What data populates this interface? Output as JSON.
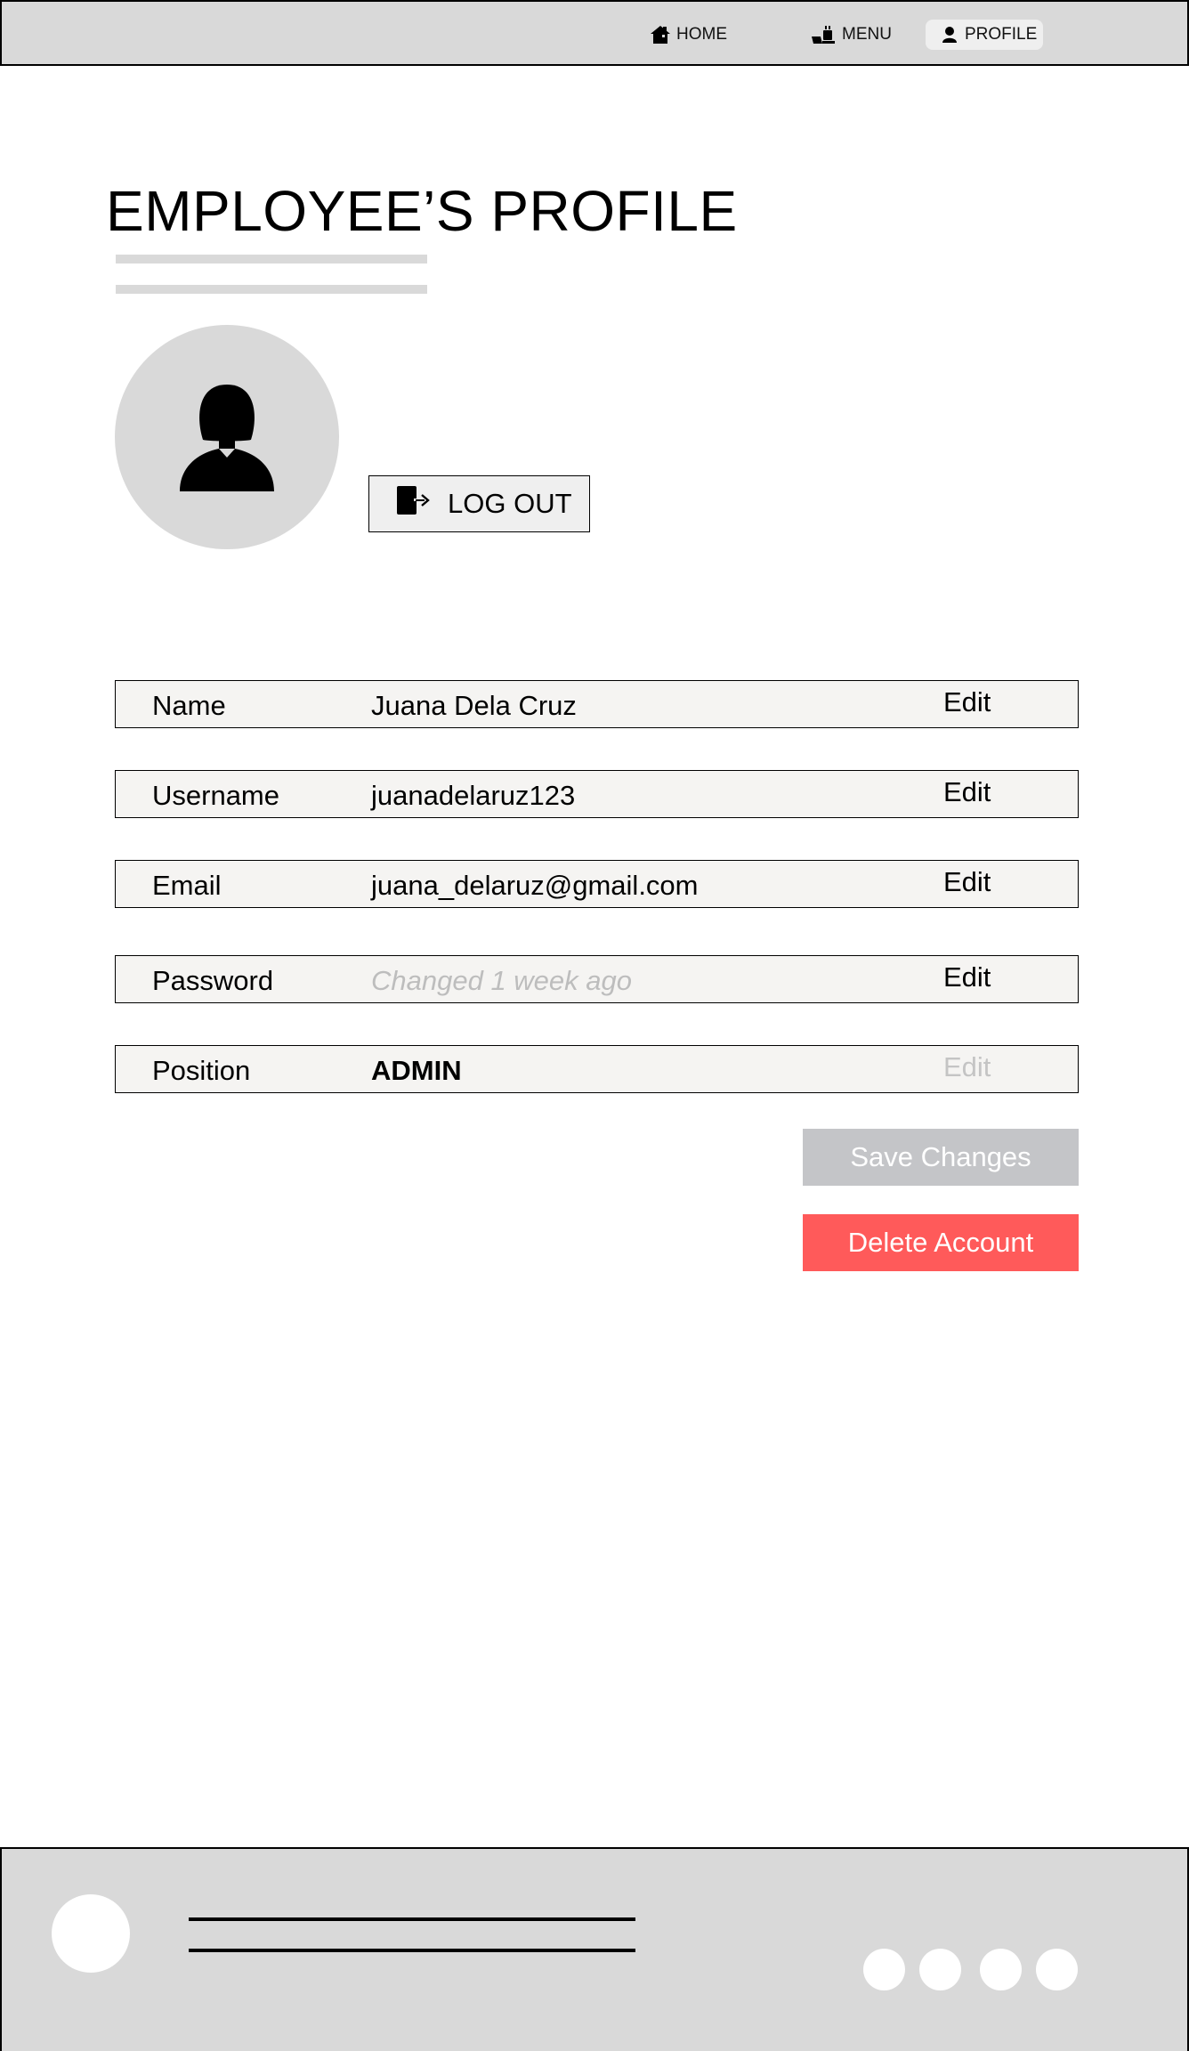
{
  "nav": {
    "items": [
      {
        "label": "HOME",
        "icon": "home-icon"
      },
      {
        "label": "MENU",
        "icon": "food-tray-icon"
      },
      {
        "label": "PROFILE",
        "icon": "user-icon",
        "active": true
      }
    ]
  },
  "page": {
    "title": "EMPLOYEE’S PROFILE"
  },
  "profile": {
    "avatar_icon": "female-user-icon",
    "logout_label": "LOG OUT",
    "logout_icon": "logout-icon",
    "rows": [
      {
        "label": "Name",
        "value": "Juana Dela Cruz",
        "edit": "Edit",
        "editable": true
      },
      {
        "label": "Username",
        "value": "juanadelaruz123",
        "edit": "Edit",
        "editable": true
      },
      {
        "label": "Email",
        "value": "juana_delaruz@gmail.com",
        "edit": "Edit",
        "editable": true
      },
      {
        "label": "Password",
        "value": "Changed 1 week ago",
        "edit": "Edit",
        "editable": true
      },
      {
        "label": "Position",
        "value": "ADMIN",
        "edit": "Edit",
        "editable": false
      }
    ]
  },
  "actions": {
    "save_label": "Save Changes",
    "delete_label": "Delete Account"
  },
  "colors": {
    "nav_bg": "#d9d9d9",
    "row_bg": "#f5f4f2",
    "save_bg": "#c4c5c8",
    "delete_bg": "#ff5a5a",
    "muted_text": "#bdbdbd"
  }
}
